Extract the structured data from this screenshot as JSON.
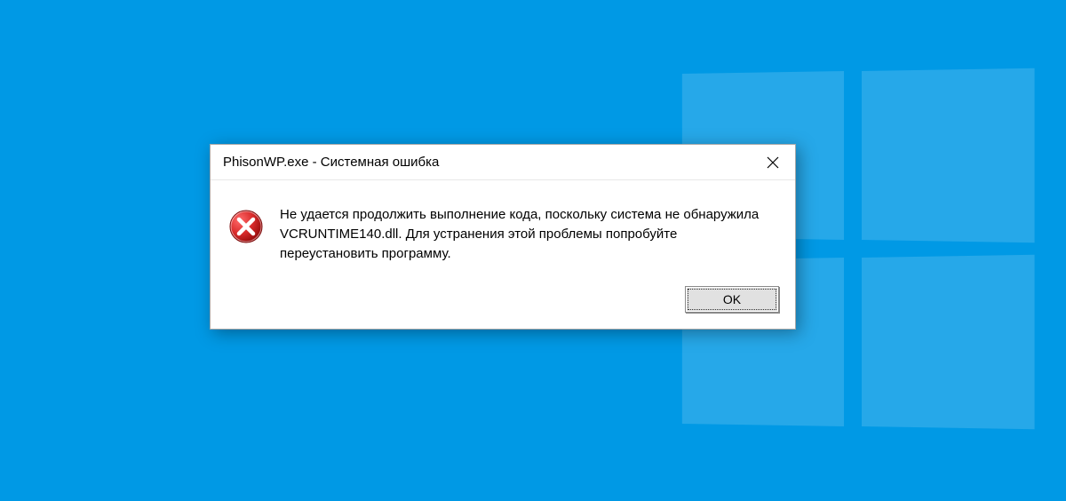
{
  "dialog": {
    "title": "PhisonWP.exe - Системная ошибка",
    "message": "Не удается продолжить выполнение кода, поскольку система не обнаружила VCRUNTIME140.dll. Для устранения этой проблемы попробуйте переустановить программу.",
    "ok_label": "OK"
  },
  "icons": {
    "error": "error-icon",
    "close": "close-icon"
  },
  "colors": {
    "desktop_bg": "#0099e5",
    "dialog_bg": "#ffffff",
    "error_red": "#d92b2b"
  }
}
